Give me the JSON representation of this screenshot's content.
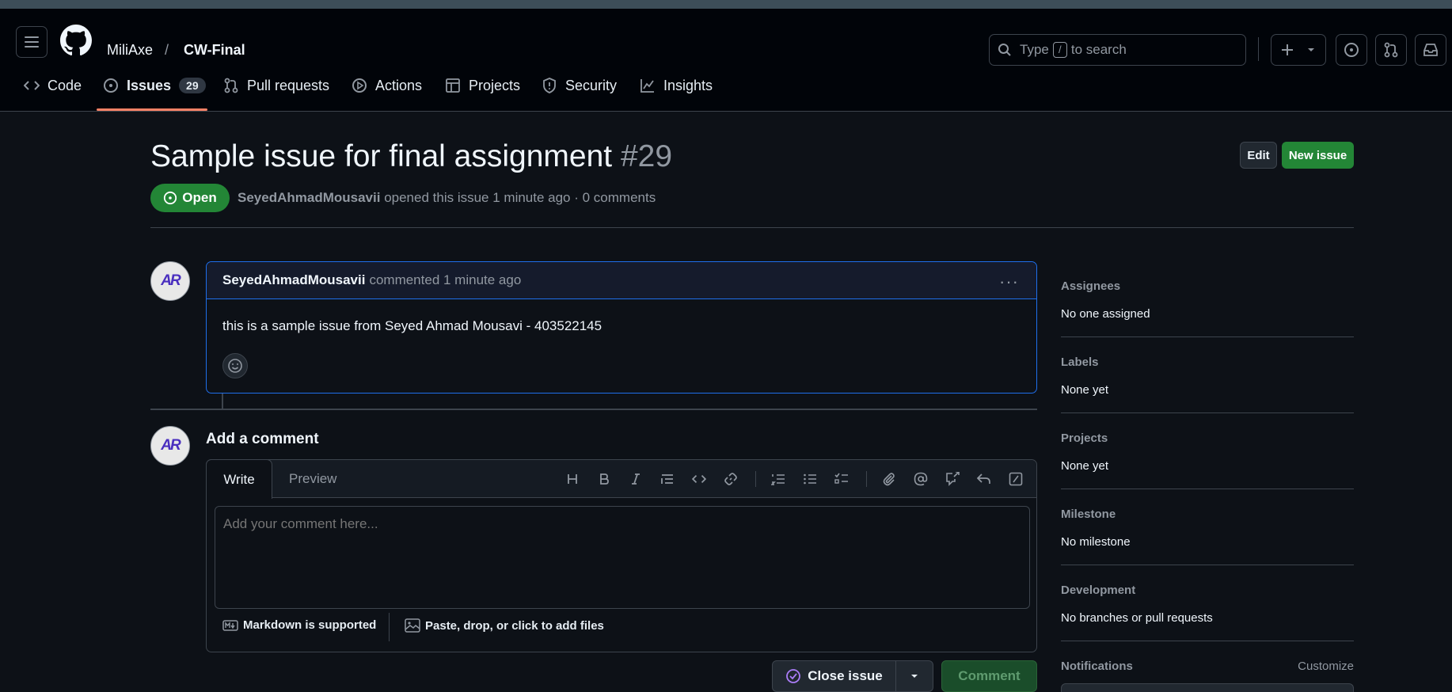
{
  "colors": {
    "accent_green": "#238636",
    "underline": "#f78166",
    "focus_blue": "#1f6feb"
  },
  "header": {
    "owner": "MiliAxe",
    "separator": "/",
    "repo": "CW-Final",
    "search_prefix": "Type",
    "search_key": "/",
    "search_suffix": "to search",
    "icons": [
      "menu-icon",
      "github-logo",
      "search-icon",
      "plus-icon",
      "chevron-down-icon",
      "issue-icon",
      "pull-request-icon",
      "inbox-icon"
    ]
  },
  "nav": [
    {
      "label": "Code",
      "icon": "code-icon"
    },
    {
      "label": "Issues",
      "icon": "issue-opened-icon",
      "count": "29",
      "active": true
    },
    {
      "label": "Pull requests",
      "icon": "pull-request-icon"
    },
    {
      "label": "Actions",
      "icon": "play-icon"
    },
    {
      "label": "Projects",
      "icon": "table-icon"
    },
    {
      "label": "Security",
      "icon": "shield-icon"
    },
    {
      "label": "Insights",
      "icon": "graph-icon"
    }
  ],
  "issue": {
    "title": "Sample issue for final assignment",
    "number": "#29",
    "state": "Open",
    "author": "SeyedAhmadMousavii",
    "meta_text": "opened this issue 1 minute ago · 0 comments",
    "edit_label": "Edit",
    "new_issue_label": "New issue"
  },
  "comment": {
    "author": "SeyedAhmadMousavii",
    "action_text": "commented 1 minute ago",
    "body": "this is a sample issue from Seyed Ahmad Mousavi - 403522145",
    "avatar_text": "AR"
  },
  "composer": {
    "heading": "Add a comment",
    "tab_write": "Write",
    "tab_preview": "Preview",
    "placeholder": "Add your comment here...",
    "markdown_note": "Markdown is supported",
    "attach_note": "Paste, drop, or click to add files",
    "close_label": "Close issue",
    "comment_label": "Comment",
    "toolbar": [
      "heading-icon",
      "bold-icon",
      "italic-icon",
      "quote-icon",
      "code-icon",
      "link-icon",
      "ordered-list-icon",
      "unordered-list-icon",
      "task-list-icon",
      "attach-icon",
      "mention-icon",
      "cross-reference-icon",
      "reply-icon",
      "slash-command-icon"
    ]
  },
  "sidebar": {
    "assignees": {
      "label": "Assignees",
      "value": "No one assigned"
    },
    "labels": {
      "label": "Labels",
      "value": "None yet"
    },
    "projects": {
      "label": "Projects",
      "value": "None yet"
    },
    "milestone": {
      "label": "Milestone",
      "value": "No milestone"
    },
    "development": {
      "label": "Development",
      "value": "No branches or pull requests"
    },
    "notifications": {
      "label": "Notifications",
      "customize": "Customize"
    }
  }
}
